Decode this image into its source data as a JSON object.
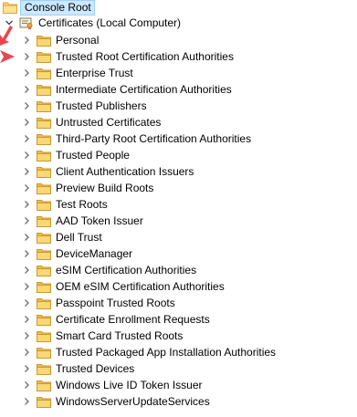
{
  "tree": {
    "root": {
      "label": "Console Root",
      "icon": "console-root-folder-icon"
    },
    "certificates_node": {
      "label": "Certificates (Local Computer)",
      "expanded": true,
      "icon": "certificate-store-icon"
    },
    "stores": [
      {
        "label": "Personal"
      },
      {
        "label": "Trusted Root Certification Authorities"
      },
      {
        "label": "Enterprise Trust"
      },
      {
        "label": "Intermediate Certification Authorities"
      },
      {
        "label": "Trusted Publishers"
      },
      {
        "label": "Untrusted Certificates"
      },
      {
        "label": "Third-Party Root Certification Authorities"
      },
      {
        "label": "Trusted People"
      },
      {
        "label": "Client Authentication Issuers"
      },
      {
        "label": "Preview Build Roots"
      },
      {
        "label": "Test Roots"
      },
      {
        "label": "AAD Token Issuer"
      },
      {
        "label": "Dell Trust"
      },
      {
        "label": "DeviceManager"
      },
      {
        "label": "eSIM Certification Authorities"
      },
      {
        "label": "OEM eSIM Certification Authorities"
      },
      {
        "label": "Passpoint Trusted Roots"
      },
      {
        "label": "Certificate Enrollment Requests"
      },
      {
        "label": "Smart Card Trusted Roots"
      },
      {
        "label": "Trusted Packaged App Installation Authorities"
      },
      {
        "label": "Trusted Devices"
      },
      {
        "label": "Windows Live ID Token Issuer"
      },
      {
        "label": "WindowsServerUpdateServices"
      }
    ]
  },
  "colors": {
    "selection_bg": "#cce8ff",
    "selection_border": "#99d1ff",
    "folder_fill": "#f8d775",
    "folder_dark": "#e6b84a",
    "chevron": "#6e6e6e",
    "annotation_arrow": "#e8474f"
  }
}
